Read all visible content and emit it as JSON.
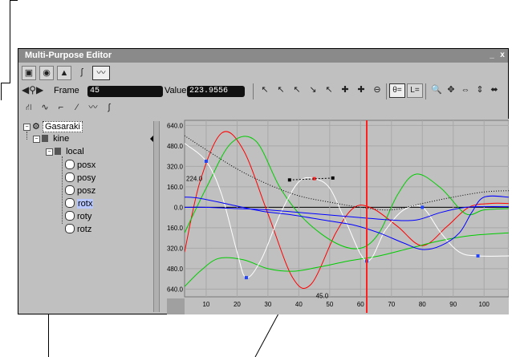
{
  "window": {
    "title": "Multi-Purpose Editor",
    "minimize_label": "_",
    "close_label": "x"
  },
  "toolbar": {
    "mode_icons": [
      "ui-icon",
      "cube-icon",
      "camera-icon",
      "function-icon",
      "curve-icon"
    ],
    "frame_label": "Frame",
    "frame_value": "45",
    "value_label": "Value",
    "value_value": "223.9556",
    "theta_label": "θ=",
    "lock_label": "L="
  },
  "tree": {
    "root": "Gasaraki",
    "child": "kine",
    "grandchild": "local",
    "channels": [
      "posx",
      "posy",
      "posz",
      "rotx",
      "roty",
      "rotz"
    ],
    "selected": "rotx"
  },
  "chart_data": {
    "type": "line",
    "xlabel": "",
    "ylabel": "",
    "xlim": [
      3,
      108
    ],
    "ylim": [
      -700,
      680
    ],
    "x_ticks": [
      10,
      20,
      30,
      40,
      50,
      60,
      70,
      80,
      90,
      100
    ],
    "y_ticks": [
      640,
      480,
      320,
      160,
      0,
      -160,
      -320,
      -480,
      -640
    ],
    "y_tick_labels": [
      "640.0",
      "480.0",
      "320.0",
      "160.0",
      "0.0",
      "-160.0",
      "-320.0",
      "-480.0",
      "-640.0"
    ],
    "current_frame": 62,
    "annotations": [
      {
        "text": "224.0",
        "x": 3,
        "y": 224
      },
      {
        "text": "45.0",
        "x": 45,
        "y": -690
      }
    ],
    "series": [
      {
        "color": "#ff0000",
        "x": [
          3,
          8,
          15,
          22,
          30,
          38,
          44,
          52,
          58,
          64,
          72,
          80,
          88,
          95,
          102,
          108
        ],
        "y": [
          -350,
          200,
          580,
          450,
          -50,
          -550,
          -600,
          -200,
          0,
          -10,
          -150,
          -300,
          -150,
          0,
          30,
          30
        ]
      },
      {
        "color": "#00cc00",
        "x": [
          3,
          10,
          18,
          26,
          34,
          42,
          52,
          60,
          66,
          72,
          78,
          86,
          94,
          100,
          108
        ],
        "y": [
          -200,
          150,
          500,
          520,
          150,
          -100,
          -280,
          -320,
          -200,
          100,
          260,
          150,
          -50,
          -20,
          -10
        ]
      },
      {
        "color": "#00cc00",
        "x": [
          3,
          8,
          14,
          22,
          30,
          38,
          46,
          56,
          66,
          76,
          86,
          96,
          108
        ],
        "y": [
          -620,
          -500,
          -400,
          -410,
          -480,
          -500,
          -470,
          -420,
          -380,
          -320,
          -260,
          -220,
          -200
        ]
      },
      {
        "color": "#ffffff",
        "x": [
          3,
          10,
          15,
          20,
          23,
          28,
          34,
          40,
          45,
          50,
          55,
          62,
          68,
          74,
          80,
          86,
          92,
          98,
          108
        ],
        "y": [
          500,
          360,
          100,
          -350,
          -550,
          -400,
          -50,
          200,
          224,
          150,
          -100,
          -420,
          -180,
          -20,
          0,
          -200,
          -350,
          -380,
          -380
        ]
      },
      {
        "color": "#0000ff",
        "x": [
          3,
          10,
          20,
          30,
          40,
          50,
          60,
          70,
          78,
          86,
          94,
          100,
          108
        ],
        "y": [
          0,
          0,
          -10,
          -20,
          -40,
          -60,
          -80,
          -100,
          -100,
          -40,
          0,
          5,
          5
        ]
      },
      {
        "color": "#0000ff",
        "x": [
          3,
          8,
          18,
          28,
          38,
          48,
          58,
          66,
          74,
          80,
          86,
          92,
          96,
          100,
          108
        ],
        "y": [
          80,
          70,
          20,
          -30,
          -60,
          -100,
          -140,
          -200,
          -280,
          -330,
          -300,
          -200,
          -40,
          80,
          80
        ]
      },
      {
        "color": "#000000",
        "dashed": true,
        "x": [
          3,
          10,
          20,
          30,
          40,
          50,
          60,
          70,
          80,
          90,
          100,
          108
        ],
        "y": [
          560,
          450,
          300,
          180,
          90,
          40,
          0,
          -20,
          30,
          80,
          120,
          130
        ]
      }
    ],
    "keys": [
      {
        "x": 10,
        "y": 360,
        "color": "#2244ff"
      },
      {
        "x": 23,
        "y": -550,
        "color": "#2244ff"
      },
      {
        "x": 62,
        "y": -420,
        "color": "#2244ff"
      },
      {
        "x": 80,
        "y": 0,
        "color": "#2244ff"
      },
      {
        "x": 98,
        "y": -380,
        "color": "#2244ff"
      },
      {
        "x": 45,
        "y": 224,
        "color": "#ff2222"
      }
    ],
    "colors": {
      "background": "#c0c0c0",
      "grid": "#a8a8a8",
      "cursor": "#ff2020"
    }
  }
}
